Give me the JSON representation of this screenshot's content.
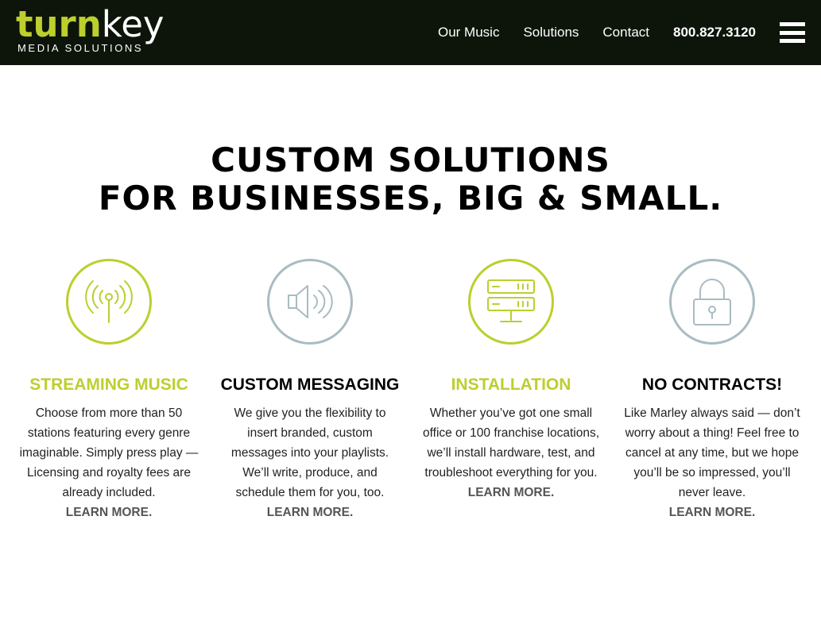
{
  "header": {
    "logo_turn": "turn",
    "logo_key": "key",
    "logo_sub": "MEDIA SOLUTIONS",
    "nav": [
      "Our Music",
      "Solutions",
      "Contact"
    ],
    "phone": "800.827.3120",
    "menu_icon": "hamburger-icon"
  },
  "headline": {
    "line1": "CUSTOM SOLUTIONS",
    "line2": "FOR BUSINESSES, BIG & SMALL."
  },
  "features": [
    {
      "icon": "broadcast-icon",
      "title": "STREAMING MUSIC",
      "text": "Choose from more than 50 stations featuring every genre imaginable. Simply press play —Licensing and royalty fees are already included.",
      "link": "LEARN MORE."
    },
    {
      "icon": "speaker-icon",
      "title": "CUSTOM MESSAGING",
      "text": "We give you the flexibility to insert branded, custom messages into your playlists. We’ll write, produce, and schedule them for you, too.",
      "link": "LEARN MORE."
    },
    {
      "icon": "server-icon",
      "title": "INSTALLATION",
      "text": "Whether you’ve got one small office or 100 franchise locations, we’ll install hardware, test, and troubleshoot everything for you.",
      "link": "LEARN MORE."
    },
    {
      "icon": "lock-icon",
      "title": "NO CONTRACTS!",
      "text": "Like Marley always said — don’t worry about a thing! Feel free to cancel at any time, but we hope you’ll be so impressed, you’ll never leave.",
      "link": "LEARN MORE."
    }
  ],
  "colors": {
    "accent": "#bccf2d",
    "header_bg": "#0d150a",
    "icon_gray": "#a9bcc2"
  }
}
